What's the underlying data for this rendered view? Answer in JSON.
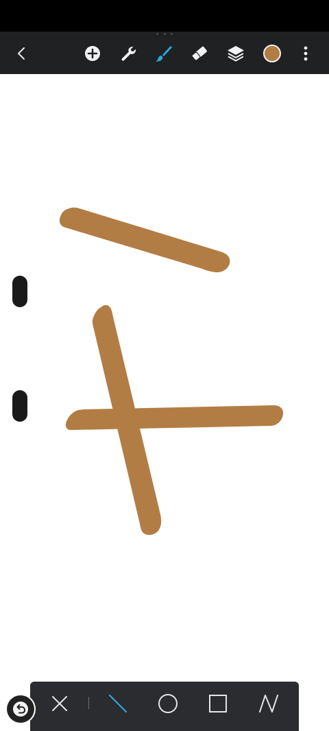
{
  "app": {
    "brush_color": "#b27d44",
    "toolbar_bg": "#1f2123",
    "accent": "#2aa8d8"
  },
  "top_toolbar": {
    "tools": [
      {
        "id": "back",
        "icon": "chevron-left-icon"
      },
      {
        "id": "add",
        "icon": "plus-circle-icon"
      },
      {
        "id": "settings",
        "icon": "wrench-icon"
      },
      {
        "id": "brush",
        "icon": "brush-icon",
        "active": true
      },
      {
        "id": "eraser",
        "icon": "eraser-icon"
      },
      {
        "id": "layers",
        "icon": "layers-icon"
      },
      {
        "id": "color",
        "icon": "color-swatch",
        "color": "#b27d44"
      },
      {
        "id": "more",
        "icon": "more-vertical-icon"
      }
    ]
  },
  "canvas": {
    "strokes": [
      {
        "name": "stroke-upper-diagonal",
        "color": "#b27d44"
      },
      {
        "name": "stroke-steep-diagonal",
        "color": "#b27d44"
      },
      {
        "name": "stroke-horizontal",
        "color": "#b27d44"
      }
    ]
  },
  "side_sliders": [
    {
      "id": "brush-size-slider"
    },
    {
      "id": "brush-opacity-slider"
    }
  ],
  "shape_bar": {
    "tools": [
      {
        "id": "close",
        "icon": "close-icon"
      },
      {
        "id": "line",
        "icon": "line-icon",
        "active": true
      },
      {
        "id": "ellipse",
        "icon": "circle-icon"
      },
      {
        "id": "rectangle",
        "icon": "square-icon"
      },
      {
        "id": "polyline",
        "icon": "polyline-icon"
      }
    ]
  },
  "undo": {
    "icon": "undo-icon"
  }
}
